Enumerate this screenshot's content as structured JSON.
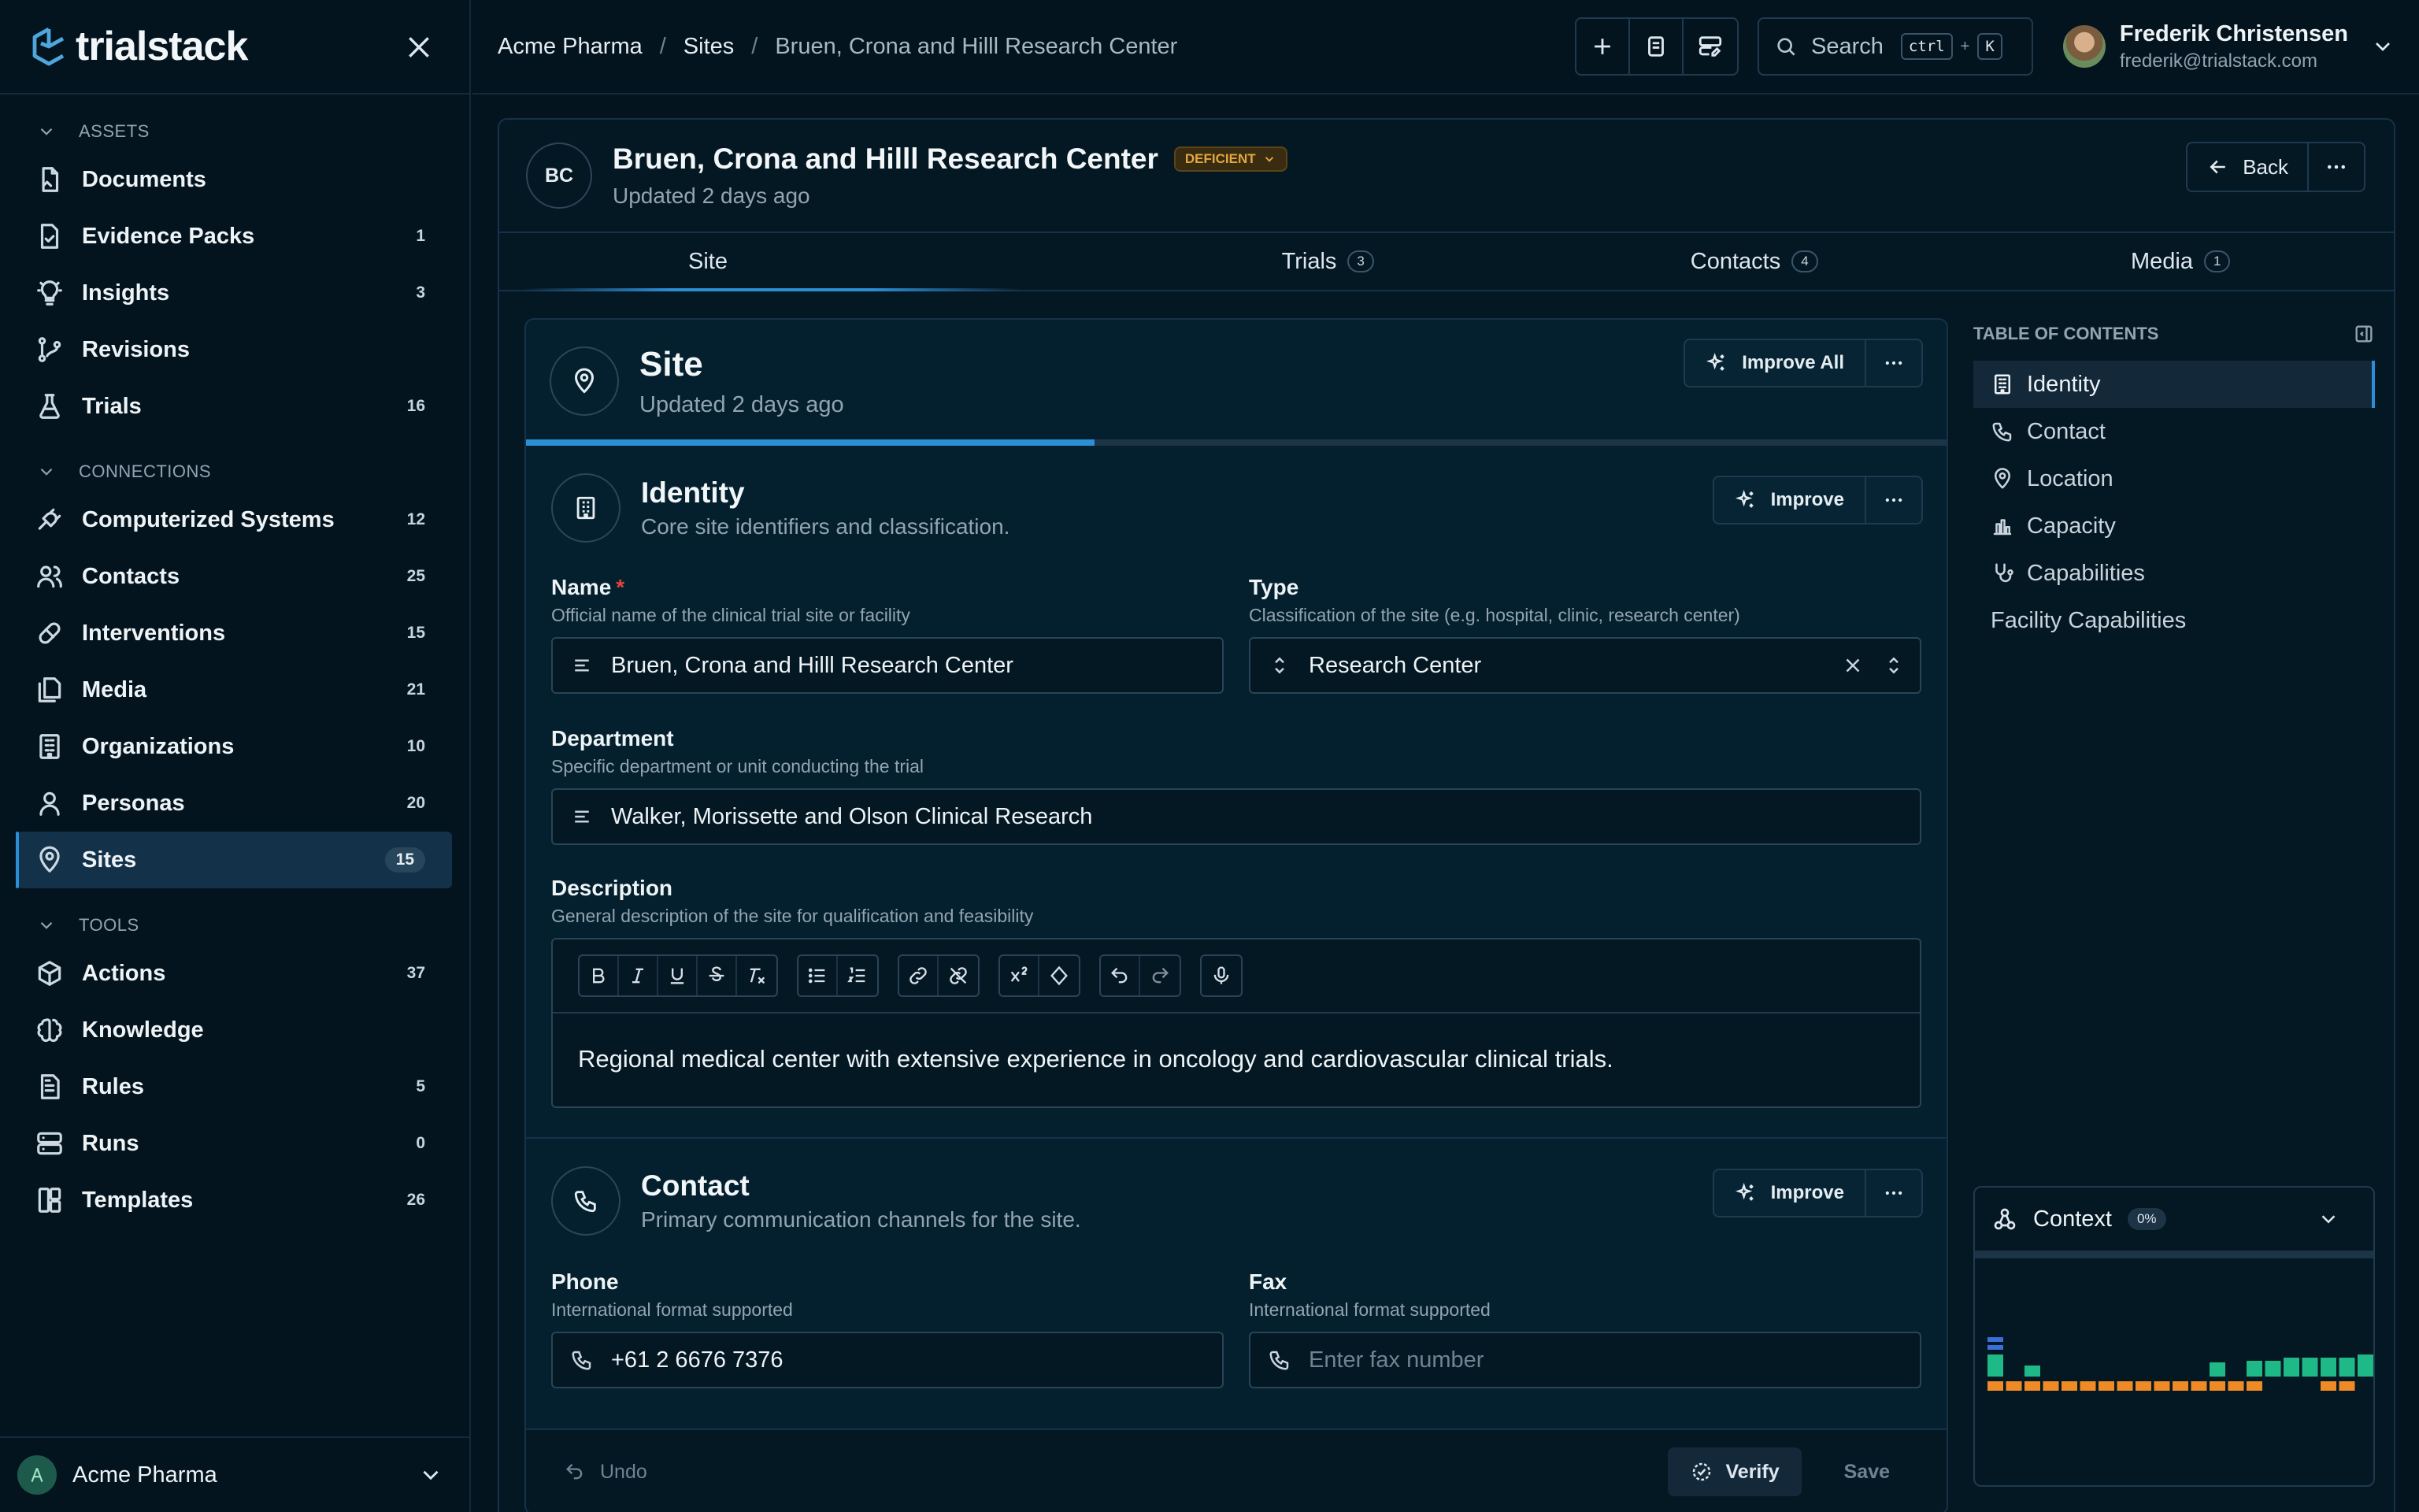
{
  "app": {
    "name": "trialstack"
  },
  "sidebar": {
    "sections": [
      {
        "title": "ASSETS",
        "items": [
          {
            "label": "Documents",
            "count": "",
            "icon": "document-icon"
          },
          {
            "label": "Evidence Packs",
            "count": "1",
            "icon": "evidence-pack-icon"
          },
          {
            "label": "Insights",
            "count": "3",
            "icon": "lightbulb-icon"
          },
          {
            "label": "Revisions",
            "count": "",
            "icon": "git-branch-icon"
          },
          {
            "label": "Trials",
            "count": "16",
            "icon": "flask-icon"
          }
        ]
      },
      {
        "title": "CONNECTIONS",
        "items": [
          {
            "label": "Computerized Systems",
            "count": "12",
            "icon": "plug-icon"
          },
          {
            "label": "Contacts",
            "count": "25",
            "icon": "users-icon"
          },
          {
            "label": "Interventions",
            "count": "15",
            "icon": "pill-icon"
          },
          {
            "label": "Media",
            "count": "21",
            "icon": "media-icon"
          },
          {
            "label": "Organizations",
            "count": "10",
            "icon": "building-icon"
          },
          {
            "label": "Personas",
            "count": "20",
            "icon": "person-icon"
          },
          {
            "label": "Sites",
            "count": "15",
            "icon": "map-pin-icon"
          }
        ]
      },
      {
        "title": "TOOLS",
        "items": [
          {
            "label": "Actions",
            "count": "37",
            "icon": "cube-icon"
          },
          {
            "label": "Knowledge",
            "count": "",
            "icon": "brain-icon"
          },
          {
            "label": "Rules",
            "count": "5",
            "icon": "rules-icon"
          },
          {
            "label": "Runs",
            "count": "0",
            "icon": "server-icon"
          },
          {
            "label": "Templates",
            "count": "26",
            "icon": "template-icon"
          }
        ]
      }
    ],
    "active_item": "Sites",
    "org": {
      "name": "Acme Pharma"
    }
  },
  "breadcrumb": [
    "Acme Pharma",
    "Sites",
    "Bruen, Crona and Hilll Research Center"
  ],
  "search": {
    "label": "Search",
    "shortcut": [
      "ctrl",
      "K"
    ]
  },
  "user": {
    "name": "Frederik Christensen",
    "email": "frederik@trialstack.com"
  },
  "record": {
    "initials": "BC",
    "title": "Bruen, Crona and Hilll Research Center",
    "status": "DEFICIENT",
    "updated": "Updated 2 days ago",
    "back_label": "Back"
  },
  "tabs": [
    {
      "label": "Site",
      "count": ""
    },
    {
      "label": "Trials",
      "count": "3"
    },
    {
      "label": "Contacts",
      "count": "4"
    },
    {
      "label": "Media",
      "count": "1"
    }
  ],
  "form": {
    "title": "Site",
    "updated": "Updated 2 days ago",
    "improve_all_label": "Improve All",
    "progress": 0.4,
    "identity": {
      "title": "Identity",
      "description": "Core site identifiers and classification.",
      "improve_label": "Improve",
      "name": {
        "label": "Name",
        "required": "*",
        "help": "Official name of the clinical trial site or facility",
        "value": "Bruen, Crona and Hilll Research Center"
      },
      "type": {
        "label": "Type",
        "help": "Classification of the site (e.g. hospital, clinic, research center)",
        "value": "Research Center"
      },
      "department": {
        "label": "Department",
        "help": "Specific department or unit conducting the trial",
        "value": "Walker, Morissette and Olson Clinical Research"
      },
      "description_field": {
        "label": "Description",
        "help": "General description of the site for qualification and feasibility",
        "value": "Regional medical center with extensive experience in oncology and cardiovascular clinical trials."
      }
    },
    "contact": {
      "title": "Contact",
      "description": "Primary communication channels for the site.",
      "improve_label": "Improve",
      "phone": {
        "label": "Phone",
        "help": "International format supported",
        "value": "+61 2 6676 7376"
      },
      "fax": {
        "label": "Fax",
        "help": "International format supported",
        "placeholder": "Enter fax number"
      }
    },
    "footer": {
      "undo_label": "Undo",
      "verify_label": "Verify",
      "save_label": "Save"
    }
  },
  "toc": {
    "title": "TABLE OF CONTENTS",
    "items": [
      {
        "label": "Identity",
        "icon": "building-icon"
      },
      {
        "label": "Contact",
        "icon": "phone-icon"
      },
      {
        "label": "Location",
        "icon": "map-pin-icon"
      },
      {
        "label": "Capacity",
        "icon": "bar-chart-icon"
      },
      {
        "label": "Capabilities",
        "icon": "stethoscope-icon"
      },
      {
        "label": "Facility Capabilities",
        "icon": ""
      }
    ]
  },
  "context": {
    "title": "Context",
    "percent": "0%",
    "colors": {
      "green": "#1fb887",
      "orange": "#f08a24",
      "blue": "#3a6fd8"
    },
    "bars_top": [
      0.7,
      0,
      0.35,
      0,
      0,
      0,
      0,
      0,
      0,
      0,
      0,
      0,
      0.45,
      0,
      0.5,
      0.5,
      0.6,
      0.6,
      0.6,
      0.6,
      0.7
    ],
    "bars_bottom": [
      0.5,
      0.5,
      0.5,
      0.5,
      0.5,
      0.5,
      0.5,
      0.5,
      0.5,
      0.5,
      0.5,
      0.5,
      0.5,
      0.5,
      0.5,
      0,
      0,
      0,
      0.5,
      0.5
    ]
  },
  "colors": {
    "accent": "#2b8fd8",
    "background": "#03141f",
    "status_deficient": "#e3a83e",
    "required": "#e2453c"
  }
}
